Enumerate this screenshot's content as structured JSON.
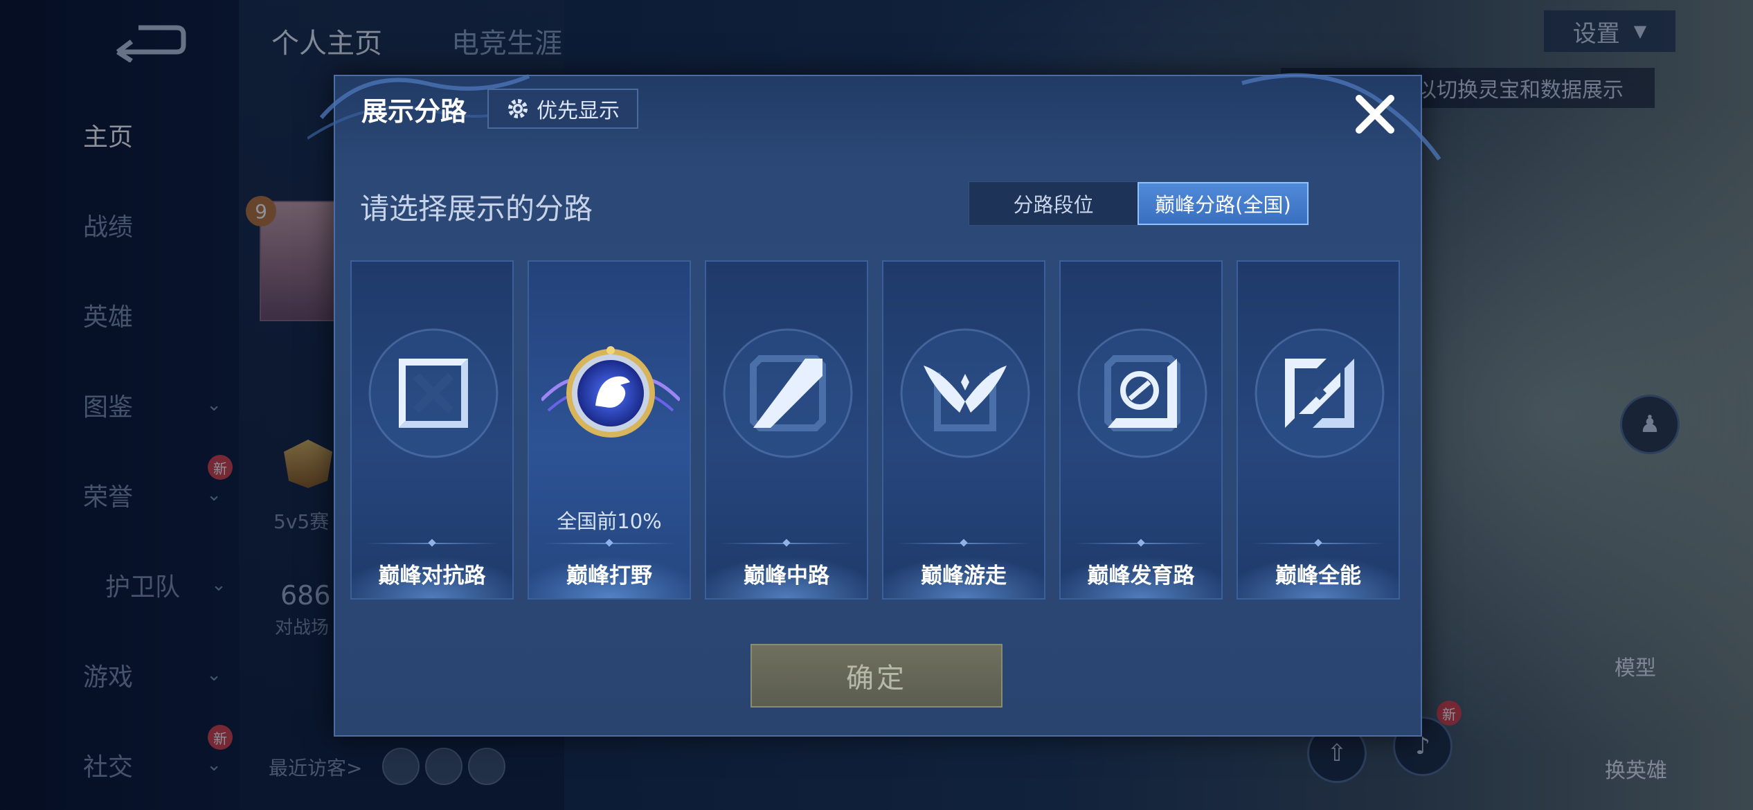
{
  "background": {
    "top_tabs": [
      "个人主页",
      "电竞生涯"
    ],
    "nav_items": [
      {
        "label": "主页",
        "active": true,
        "chevron": false,
        "badge": ""
      },
      {
        "label": "战绩",
        "active": false,
        "chevron": false,
        "badge": ""
      },
      {
        "label": "英雄",
        "active": false,
        "chevron": false,
        "badge": ""
      },
      {
        "label": "图鉴",
        "active": false,
        "chevron": true,
        "badge": ""
      },
      {
        "label": "荣誉",
        "active": false,
        "chevron": true,
        "badge": "新"
      },
      {
        "label": "护卫队",
        "active": false,
        "chevron": true,
        "badge": ""
      },
      {
        "label": "游戏",
        "active": false,
        "chevron": true,
        "badge": ""
      },
      {
        "label": "社交",
        "active": false,
        "chevron": true,
        "badge": "新"
      }
    ],
    "settings_label": "设置",
    "hint_text": "以切换灵宝和数据展示",
    "recent_visitors_label": "最近访客>",
    "side_texts": {
      "level": "9",
      "mode": "5v5赛",
      "count": "686",
      "count_label": "对战场"
    },
    "right_buttons": {
      "model_label": "模型",
      "switch_hero_label": "换英雄",
      "new_badge": "新"
    }
  },
  "modal": {
    "title": "展示分路",
    "priority_label": "优先显示",
    "subtitle": "请选择展示的分路",
    "toggle": {
      "options": [
        "分路段位",
        "巅峰分路(全国)"
      ],
      "active_index": 1
    },
    "lanes": [
      {
        "name": "巅峰对抗路",
        "icon": "clash-lane-icon",
        "rank": ""
      },
      {
        "name": "巅峰打野",
        "icon": "jungle-emblem-icon",
        "rank": "全国前10%"
      },
      {
        "name": "巅峰中路",
        "icon": "mid-lane-icon",
        "rank": ""
      },
      {
        "name": "巅峰游走",
        "icon": "roam-wings-icon",
        "rank": ""
      },
      {
        "name": "巅峰发育路",
        "icon": "farm-lane-icon",
        "rank": ""
      },
      {
        "name": "巅峰全能",
        "icon": "all-round-icon",
        "rank": ""
      }
    ],
    "selected_lane_index": 1,
    "confirm_label": "确定",
    "colors": {
      "accent": "#4f8ad8",
      "panel": "#2a4674",
      "confirm_disabled": "#6f705e"
    }
  }
}
